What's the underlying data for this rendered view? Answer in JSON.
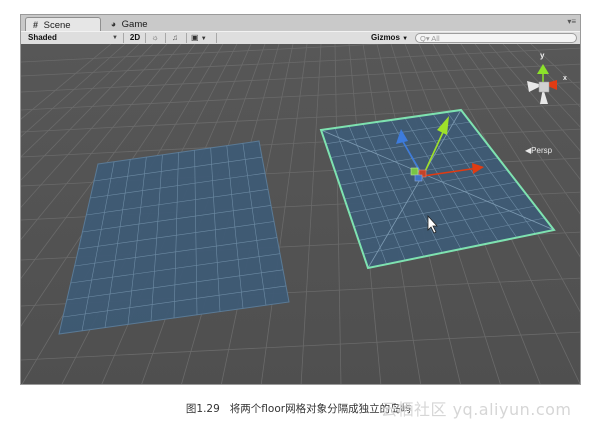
{
  "tabs": [
    {
      "label": "Scene",
      "icon": "grid-icon"
    },
    {
      "label": "Game",
      "icon": "pacman-icon"
    }
  ],
  "toolbar": {
    "shading": "Shaded",
    "mode_2d": "2D",
    "gizmos": "Gizmos",
    "search_placeholder": "All"
  },
  "viewport": {
    "projection_label": "Persp",
    "axis_labels": {
      "y": "y",
      "x": "x"
    },
    "background_color": "#545454",
    "plane_color": "#3d5a75",
    "selection_outline_color": "#7ee2b0",
    "axis_colors": {
      "x": "#e03b12",
      "y": "#9ee12a",
      "z": "#3d7bdc"
    }
  },
  "caption": {
    "figure": "图1.29",
    "text": "将两个floor网格对象分隔成独立的岛屿"
  },
  "watermark": "云栖社区 yq.aliyun.com"
}
